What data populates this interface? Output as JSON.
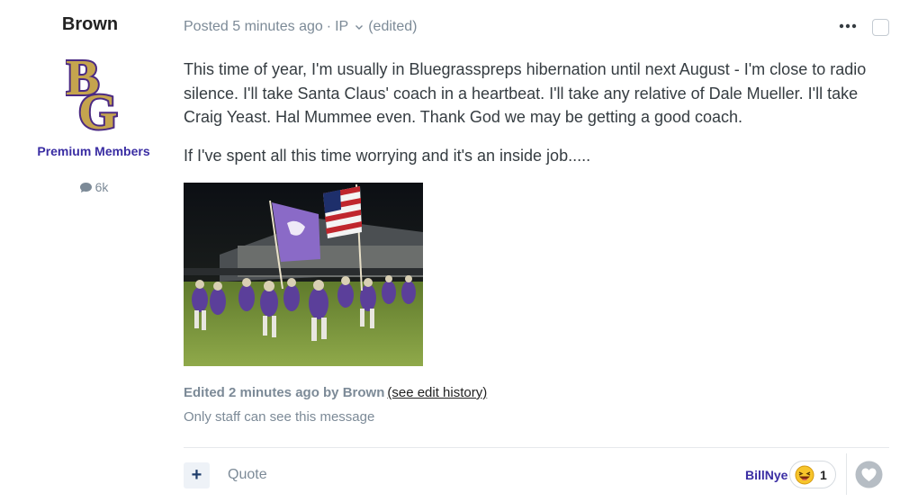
{
  "author": {
    "name": "Brown",
    "avatar_letters": "BG",
    "group": "Premium Members",
    "post_count": "6k"
  },
  "post": {
    "meta_posted": "Posted 5 minutes ago",
    "meta_sep": "·",
    "meta_ip": "IP",
    "meta_edited": "(edited)",
    "paragraph1": "This time of year, I'm usually in Bluegrasspreps hibernation until next August - I'm close to radio silence.  I'll take Santa Claus' coach in a heartbeat.  I'll take any relative of Dale Mueller.  I'll take Craig Yeast.  Hal Mummee even.  Thank God we may be getting a good coach.",
    "paragraph2": "If I've spent all this time worrying and it's an inside job.....",
    "photo_alt": "Football team running onto field with purple flag and American flag",
    "edited_note": "Edited 2 minutes ago by Brown",
    "edit_history_link": "(see edit history)",
    "staff_note": "Only staff can see this message"
  },
  "footer": {
    "plus_label": "+",
    "quote_label": "Quote",
    "reactor_name": "BillNye",
    "reaction_count": "1",
    "reaction_emoji": "laughing-face"
  },
  "colors": {
    "accent": "#3a2da3",
    "muted": "#7c8a97",
    "logo_purple": "#4b2a83",
    "logo_gold": "#c5a44e"
  }
}
